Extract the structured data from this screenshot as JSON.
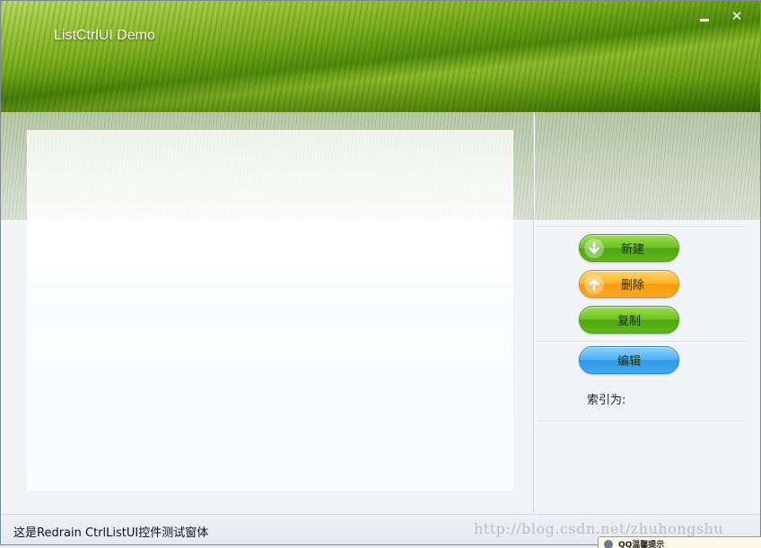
{
  "window": {
    "title": "ListCtrlUI Demo",
    "minimize_glyph": "",
    "close_glyph": "✕"
  },
  "actions": {
    "new_label": "新建",
    "delete_label": "删除",
    "copy_label": "复制",
    "edit_label": "编辑",
    "new_icon": "arrow-down-icon",
    "delete_icon": "arrow-up-icon"
  },
  "index": {
    "label": "索引为:"
  },
  "statusbar": {
    "text": "这是Redrain CtrlListUI控件测试窗体",
    "watermark": "http://blog.csdn.net/zhuhongshu"
  },
  "tooltip": {
    "text": "QQ温馨提示"
  },
  "colors": {
    "green_button": "#6cc224",
    "orange_button": "#fdb42a",
    "blue_button": "#4fb1f4"
  }
}
